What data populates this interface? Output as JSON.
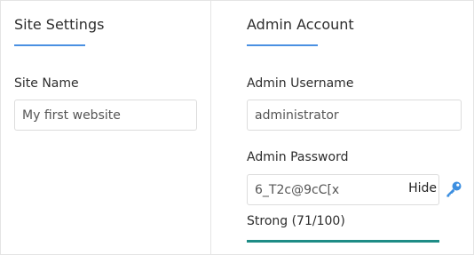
{
  "site_settings": {
    "title": "Site Settings",
    "site_name_label": "Site Name",
    "site_name_value": "My first website"
  },
  "admin_account": {
    "title": "Admin Account",
    "username_label": "Admin Username",
    "username_value": "administrator",
    "password_label": "Admin Password",
    "password_value": "6_T2c@9cC[x",
    "hide_label": "Hide",
    "strength_text": "Strong (71/100)",
    "strength_fraction": 1.0
  },
  "icons": {
    "generate_password": "key-icon"
  },
  "colors": {
    "accent": "#4a90e2",
    "strength_bar": "#1e8c86",
    "key_icon": "#3d8fe0"
  }
}
